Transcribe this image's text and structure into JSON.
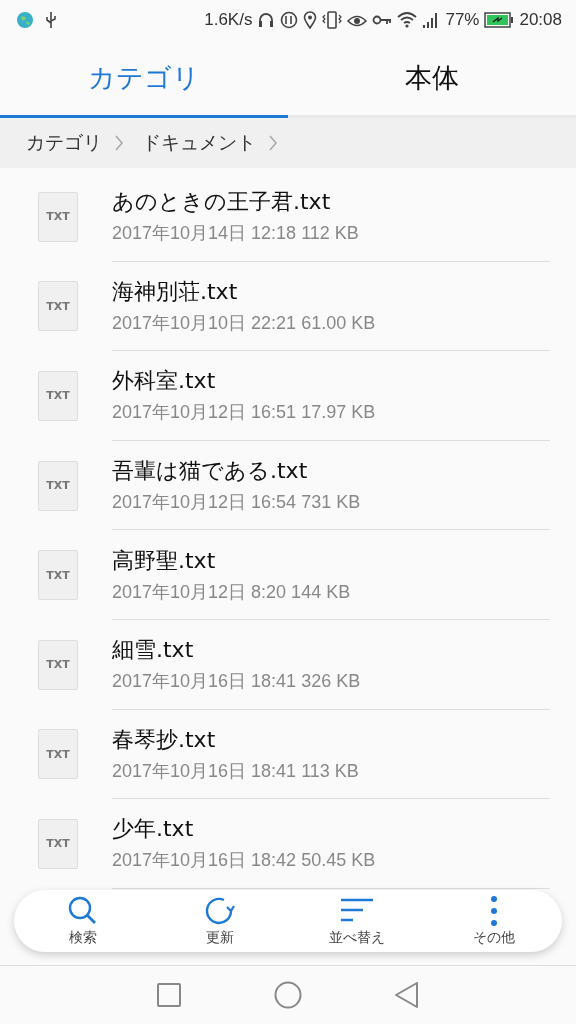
{
  "status_bar": {
    "speed": "1.6K/s",
    "battery": "77%",
    "time": "20:08"
  },
  "tabs": [
    {
      "label": "カテゴリ",
      "selected": true
    },
    {
      "label": "本体",
      "selected": false
    }
  ],
  "breadcrumb": [
    "カテゴリ",
    "ドキュメント"
  ],
  "files": [
    {
      "name": "あのときの王子君.txt",
      "meta": "2017年10月14日 12:18 112 KB",
      "icon": "TXT"
    },
    {
      "name": "海神別荘.txt",
      "meta": "2017年10月10日 22:21 61.00 KB",
      "icon": "TXT"
    },
    {
      "name": "外科室.txt",
      "meta": "2017年10月12日 16:51 17.97 KB",
      "icon": "TXT"
    },
    {
      "name": "吾輩は猫である.txt",
      "meta": "2017年10月12日 16:54 731 KB",
      "icon": "TXT"
    },
    {
      "name": "高野聖.txt",
      "meta": "2017年10月12日 8:20 144 KB",
      "icon": "TXT"
    },
    {
      "name": "細雪.txt",
      "meta": "2017年10月16日 18:41 326 KB",
      "icon": "TXT"
    },
    {
      "name": "春琴抄.txt",
      "meta": "2017年10月16日 18:41 113 KB",
      "icon": "TXT"
    },
    {
      "name": "少年.txt",
      "meta": "2017年10月16日 18:42 50.45 KB",
      "icon": "TXT"
    }
  ],
  "toolbar": [
    {
      "kind": "search",
      "label": "検索"
    },
    {
      "kind": "refresh",
      "label": "更新"
    },
    {
      "kind": "sort",
      "label": "並べ替え"
    },
    {
      "kind": "more",
      "label": "その他"
    }
  ]
}
